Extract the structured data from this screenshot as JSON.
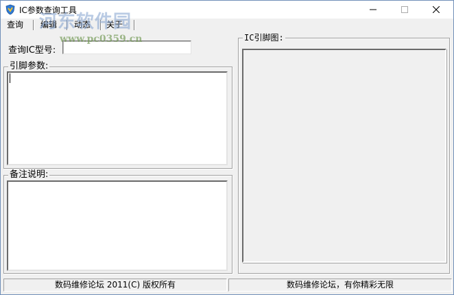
{
  "window": {
    "title": "IC参数查询工具",
    "controls": {
      "minimize_glyph": "─",
      "maximize_glyph": "☐",
      "close_glyph": "✕"
    },
    "icon": "app-shield-icon"
  },
  "watermark": {
    "brand": "河东软件园",
    "url": "www.pc0359.cn"
  },
  "menu": {
    "items": [
      {
        "label": "查询"
      },
      {
        "label": "编辑"
      },
      {
        "label": "动态"
      },
      {
        "label": "关于"
      }
    ]
  },
  "search": {
    "label": "查询IC型号:",
    "value": ""
  },
  "pins_group": {
    "title": "引脚参数:",
    "content": ""
  },
  "notes_group": {
    "title": "备注说明:",
    "content": ""
  },
  "diagram_group": {
    "title": "IC引脚图:"
  },
  "status": {
    "left": "数码维修论坛 2011(C) 版权所有",
    "right": "数码维修论坛，有你精彩无限"
  },
  "colors": {
    "window_bg": "#f0f0f0",
    "border": "#6f8fb8",
    "icon_blue": "#2f7bd6",
    "icon_yellow": "#f2c12e"
  }
}
